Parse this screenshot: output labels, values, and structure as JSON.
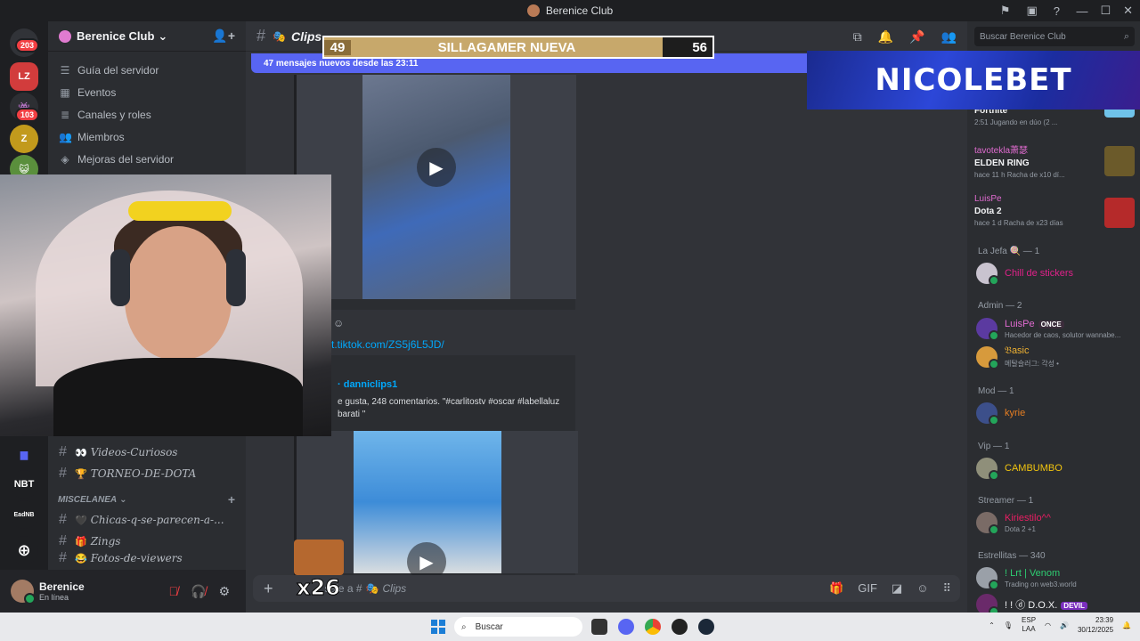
{
  "window": {
    "title": "Berenice Club"
  },
  "guilds": {
    "badges": [
      "203",
      "103"
    ],
    "labels": [
      "NBT",
      "EadNB"
    ]
  },
  "server": {
    "name": "Berenice Club",
    "menu": [
      "Guía del servidor",
      "Eventos",
      "Canales y roles",
      "Miembros",
      "Mejoras del servidor"
    ],
    "channels": [
      {
        "emoji": "👀",
        "name": "Videos-Curiosos"
      },
      {
        "emoji": "🏆",
        "name": "TORNEO-DE-DOTA"
      }
    ],
    "category": "MISCELANEA",
    "channels2": [
      {
        "emoji": "🖤",
        "name": "Chicas-q-se-parecen-a-..."
      },
      {
        "emoji": "🎁",
        "name": "Zings"
      },
      {
        "emoji": "😂",
        "name": "Fotos-de-viewers"
      }
    ]
  },
  "user": {
    "name": "Berenice",
    "status": "En línea"
  },
  "channel": {
    "name": "Clips",
    "new_messages": "47 mensajes nuevos desde las 23:11",
    "link": "t.tiktok.com/ZS5j6L5JD/",
    "embed_author": "· danniclips1",
    "embed_desc": "e gusta, 248 comentarios. \"#carlitostv #oscar #labellaluz\nbarati \"",
    "composer_placeholder": "saje a #",
    "composer_channel": "Clips"
  },
  "overlay": {
    "poll_left": "49",
    "poll_title": "SILLAGAMER NUEVA",
    "poll_right": "56",
    "banner": "NICOLEBET",
    "combo": "x26"
  },
  "members": {
    "search_placeholder": "Buscar Berenice Club",
    "activities": [
      {
        "user": "",
        "game": "Fortnite",
        "meta": "2:51  Jugando en dúo (2 ..."
      },
      {
        "user": "tavotekla萧瑟",
        "game": "ELDEN RING",
        "meta": "hace 11 h   Racha de x10 dí..."
      },
      {
        "user": "LuisPe",
        "game": "Dota 2",
        "meta": "hace 1 d   Racha de x23 días"
      }
    ],
    "groups": [
      {
        "title": "La Jefa 🍭 — 1",
        "members": [
          {
            "name": "Chill de stickers",
            "sub": "",
            "color": "#e0218a"
          }
        ]
      },
      {
        "title": "Admin — 2",
        "members": [
          {
            "name": "LuisPe",
            "tag": "ONCE",
            "sub": "Hacedor de caos, solutor wannabe...",
            "color": "#e06bd0"
          },
          {
            "name": "𝔅asic",
            "sub": "메탈슬러그: 각성 •",
            "color": "#f0b232"
          }
        ]
      },
      {
        "title": "Mod — 1",
        "members": [
          {
            "name": "kyrie",
            "sub": "",
            "color": "#e67e22"
          }
        ]
      },
      {
        "title": "Vip — 1",
        "members": [
          {
            "name": "CAMBUMBO",
            "sub": "",
            "color": "#f1c40f"
          }
        ]
      },
      {
        "title": "Streamer — 1",
        "members": [
          {
            "name": "Kiriestilo^^",
            "sub": "Dota 2 +1",
            "color": "#e91e63"
          }
        ]
      },
      {
        "title": "Estrellitas — 340",
        "members": [
          {
            "name": "! Lrt | Venom",
            "sub": "Trading on web3.world",
            "color": "#2ecc71"
          },
          {
            "name": "! ! ⓓ D.O.X.",
            "tag": "DEVIL",
            "sub": "",
            "color": "#f2f3f5"
          }
        ]
      }
    ]
  },
  "taskbar": {
    "search": "Buscar",
    "lang1": "ESP",
    "lang2": "LAA",
    "time": "23:39",
    "date": "30/12/2025"
  }
}
